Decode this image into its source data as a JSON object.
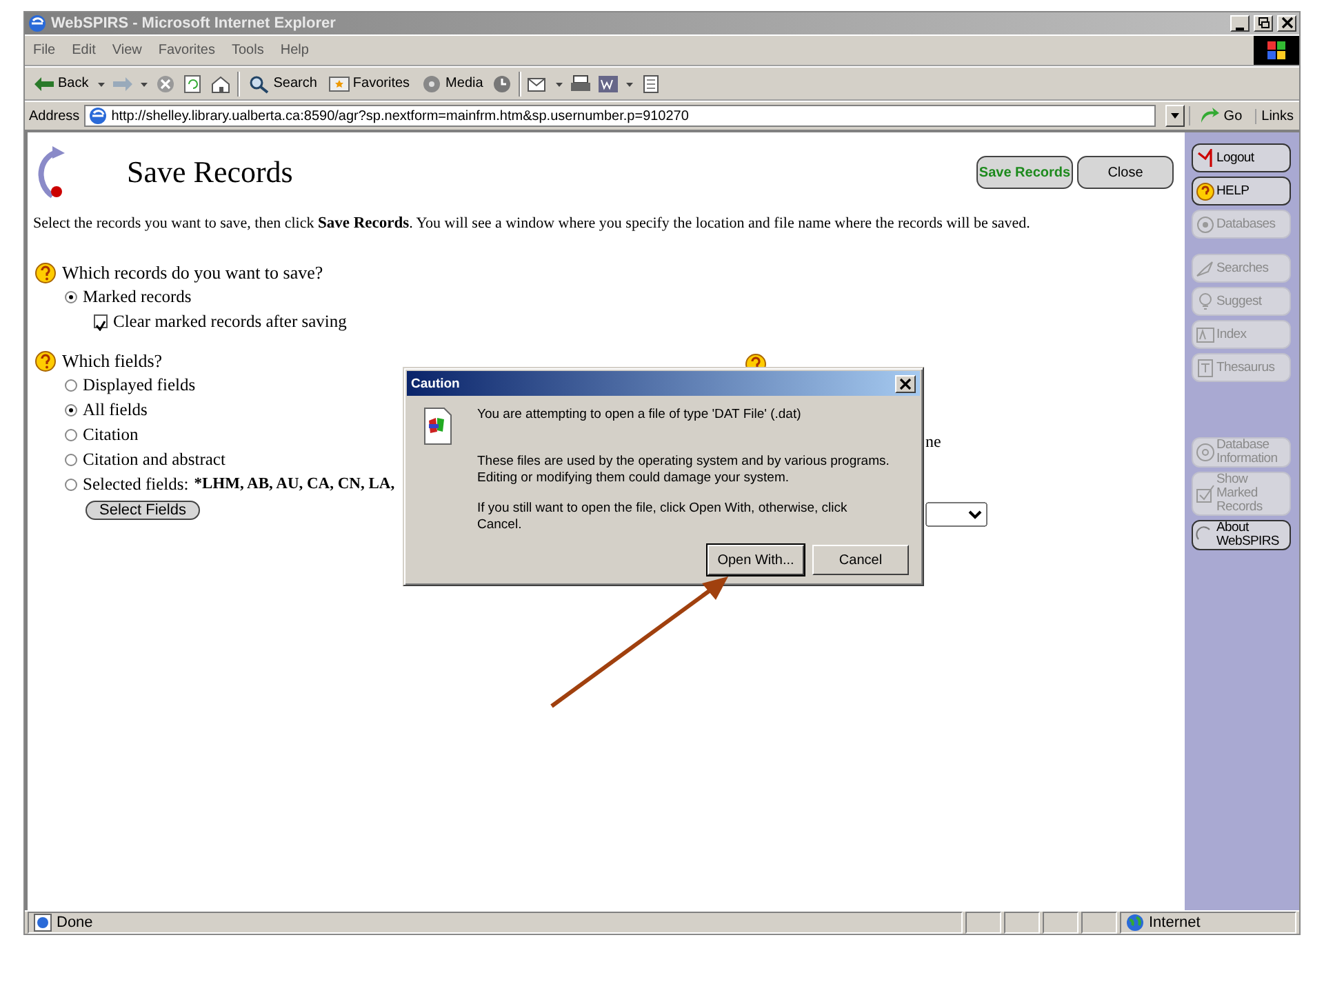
{
  "window": {
    "title": "WebSPIRS - Microsoft Internet Explorer"
  },
  "menu_bar": [
    "File",
    "Edit",
    "View",
    "Favorites",
    "Tools",
    "Help"
  ],
  "toolbar": {
    "back": "Back",
    "search": "Search",
    "favorites": "Favorites",
    "media": "Media"
  },
  "address_bar": {
    "label": "Address",
    "url": "http://shelley.library.ualberta.ca:8590/agr?sp.nextform=mainfrm.htm&sp.usernumber.p=910270",
    "go": "Go",
    "links": "Links"
  },
  "page": {
    "title": "Save Records",
    "buttons": [
      {
        "label": "Save Records",
        "kind": "primary"
      },
      {
        "label": "Close",
        "kind": "plain"
      }
    ],
    "instructions": "Select the records you want to save, then click **Save Records**. You will see a window where you specify the location and file name where the records will be saved.",
    "records_question": {
      "label": "Which records do you want to save?",
      "options": [
        {
          "label": "Marked records",
          "selected": true
        }
      ],
      "clear_marked": {
        "label": "Clear marked records after saving",
        "checked": true
      }
    },
    "fields_question": {
      "label": "Which fields?",
      "options": [
        {
          "label": "Displayed fields",
          "selected": false
        },
        {
          "label": "All fields",
          "selected": true
        },
        {
          "label": "Citation",
          "selected": false
        },
        {
          "label": "Citation and abstract",
          "selected": false
        },
        {
          "label": "Selected fields:",
          "selected": false,
          "value": "*LHM, AB, AU, CA, CN, LA,"
        }
      ],
      "select_button": "Select Fields"
    },
    "partial_text": "ne"
  },
  "sidebar": {
    "groups": [
      {
        "items": [
          {
            "label": "Logout",
            "disabled": false
          },
          {
            "label": "HELP",
            "disabled": false
          },
          {
            "label": "Databases",
            "disabled": true
          }
        ]
      },
      {
        "items": [
          {
            "label": "Searches",
            "disabled": true
          },
          {
            "label": "Suggest",
            "disabled": true
          },
          {
            "label": "Index",
            "disabled": true
          },
          {
            "label": "Thesaurus",
            "disabled": true
          }
        ]
      },
      {
        "items": [
          {
            "label": "Database Information",
            "disabled": true
          },
          {
            "label": "Show Marked Records",
            "disabled": true
          },
          {
            "label": "About WebSPIRS",
            "disabled": false
          }
        ]
      }
    ]
  },
  "dialog": {
    "title": "Caution",
    "message": "You are attempting to open a file of type 'DAT File' (.dat)",
    "warning": "These files are used by the operating system and by various programs. Editing or modifying them could damage your system.",
    "instruction": "If you still want to open the file, click Open With, otherwise, click Cancel.",
    "buttons": [
      {
        "label": "Open With...",
        "focused": true
      },
      {
        "label": "Cancel",
        "focused": false
      }
    ]
  },
  "status_bar": {
    "text": "Done",
    "zone": "Internet"
  }
}
